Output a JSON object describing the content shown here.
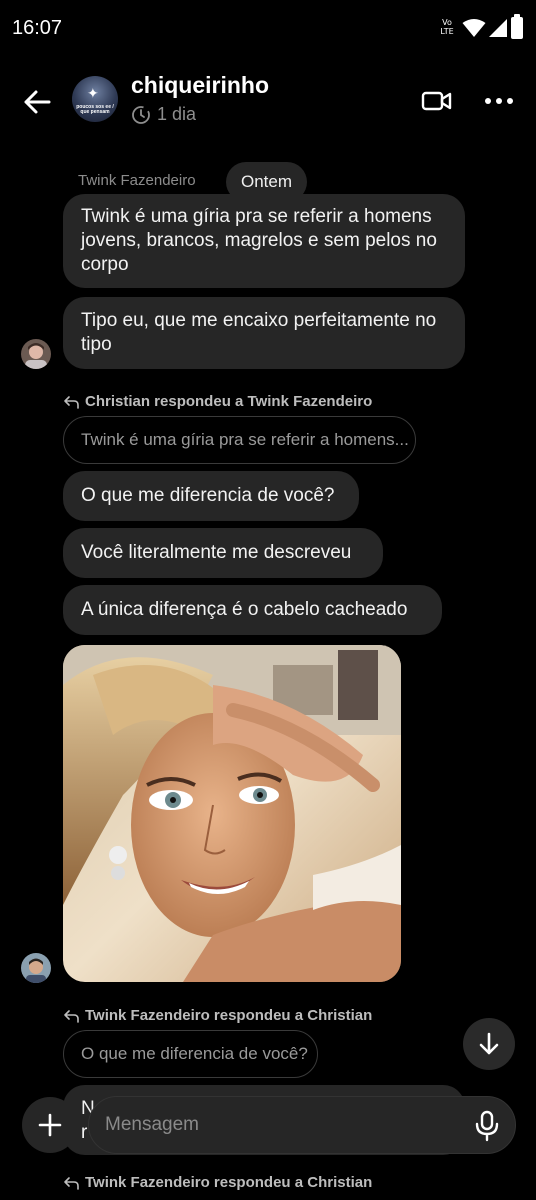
{
  "status_bar": {
    "time": "16:07",
    "volte_top": "Vo",
    "volte_bottom": "LTE"
  },
  "header": {
    "title": "chiqueirinho",
    "subtitle": "1 dia",
    "group_avatar_text": "poucos sos ee / que pensam"
  },
  "chat": {
    "first_sender": "Twink Fazendeiro",
    "date_separator": "Ontem",
    "messages_a": [
      "Twink é uma gíria pra se referir a homens jovens, brancos, magrelos e sem pelos no corpo",
      "Tipo eu, que me encaixo perfeitamente no tipo"
    ],
    "reply_1": {
      "label": "Christian respondeu a Twink Fazendeiro",
      "quote": "Twink é uma gíria pra se referir a homens..."
    },
    "messages_b": [
      "O que me diferencia de você?",
      "Você literalmente me descreveu",
      "A única diferença é o cabelo cacheado"
    ],
    "reply_2": {
      "label": "Twink Fazendeiro respondeu a Christian",
      "quote": "O que me diferencia de você?"
    },
    "partial_message": "N r",
    "reply_3_label": "Twink Fazendeiro respondeu a Christian"
  },
  "composer": {
    "placeholder": "Mensagem"
  },
  "colors": {
    "background": "#000000",
    "bubble": "#262626",
    "secondary_text": "#8c8c8c"
  },
  "icons": {
    "back": "arrow-left-icon",
    "clock": "clock-icon",
    "video": "video-camera-icon",
    "more": "more-dots-icon",
    "reply": "reply-arrow-icon",
    "scroll_down": "arrow-down-icon",
    "plus": "plus-icon",
    "mic": "microphone-icon"
  }
}
